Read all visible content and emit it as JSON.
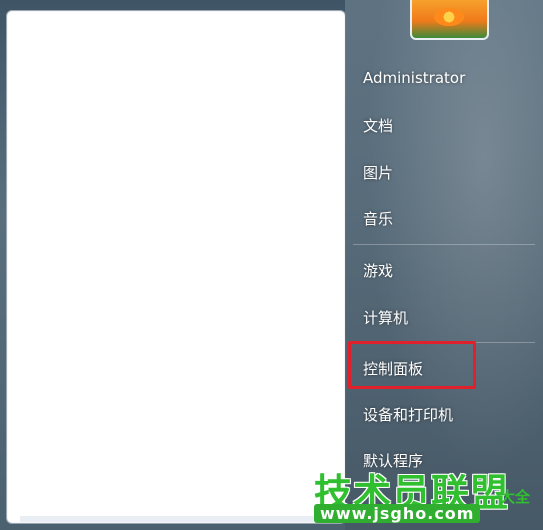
{
  "user": {
    "name": "Administrator"
  },
  "menu": {
    "items": [
      {
        "label": "文档"
      },
      {
        "label": "图片"
      },
      {
        "label": "音乐"
      },
      {
        "label": "游戏"
      },
      {
        "label": "计算机"
      },
      {
        "label": "控制面板"
      },
      {
        "label": "设备和打印机"
      },
      {
        "label": "默认程序"
      }
    ]
  },
  "watermark": {
    "title": "技术员联盟",
    "side": "大全",
    "url": "www.jsgho.com"
  },
  "colors": {
    "highlight": "#e0202a",
    "watermark_green": "#2fbf2f"
  }
}
